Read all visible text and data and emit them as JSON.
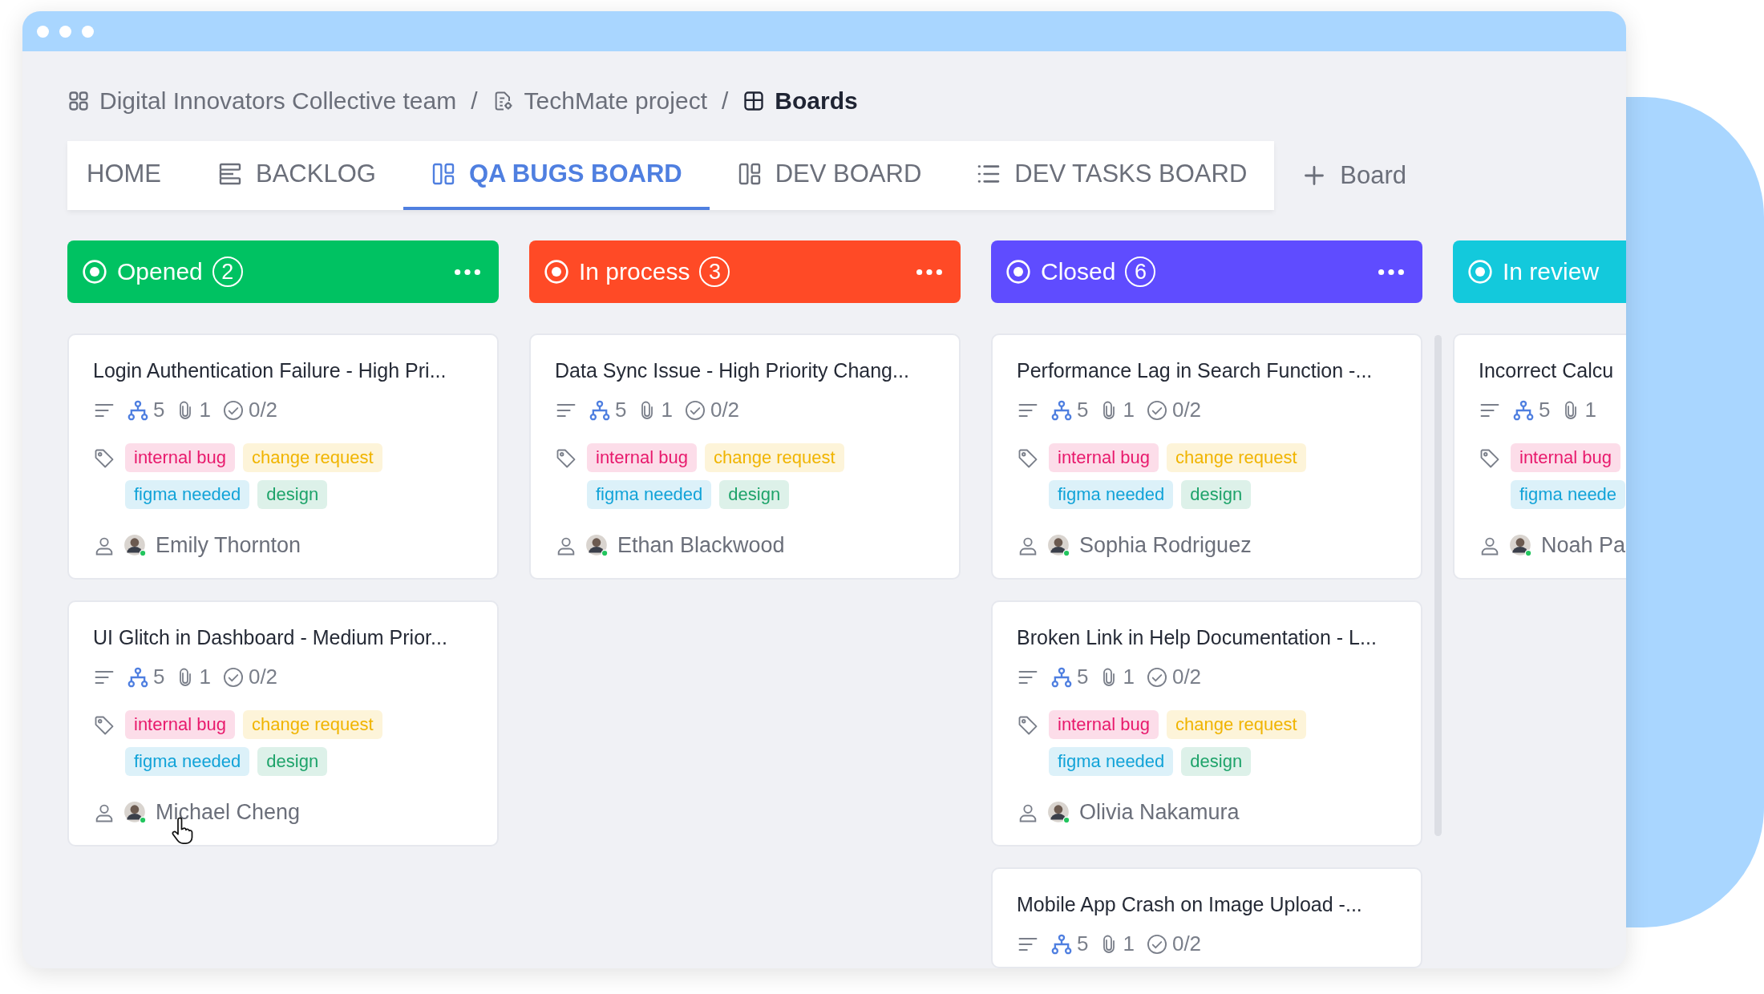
{
  "breadcrumb": [
    {
      "label": "Digital Innovators Collective team",
      "kind": "team",
      "current": false
    },
    {
      "label": "TechMate project",
      "kind": "project",
      "current": false
    },
    {
      "label": "Boards",
      "kind": "boards",
      "current": true
    }
  ],
  "separator": "/",
  "tabs": [
    {
      "label": "HOME",
      "kind": "plain",
      "selected": false
    },
    {
      "label": "BACKLOG",
      "kind": "backlog",
      "selected": false
    },
    {
      "label": "QA BUGS BOARD",
      "kind": "board",
      "selected": true
    },
    {
      "label": "DEV BOARD",
      "kind": "board",
      "selected": false
    },
    {
      "label": "DEV TASKS BOARD",
      "kind": "list",
      "selected": false
    }
  ],
  "add_board": {
    "label": "Board"
  },
  "columns": [
    {
      "name": "Opened",
      "count": "2",
      "color": "#00c262",
      "cards": [
        {
          "title": "Login Authentication Failure - High Pri...",
          "subtasks": "5",
          "attachments": "1",
          "checklist": "0/2",
          "tags": [
            {
              "label": "internal bug",
              "color": "#e8196c"
            },
            {
              "label": "change request",
              "color": "#f0b400"
            },
            {
              "label": "figma needed",
              "color": "#12a3d8"
            },
            {
              "label": "design",
              "color": "#1ea36a"
            }
          ],
          "assignee": "Emily Thornton"
        },
        {
          "title": "UI Glitch in Dashboard - Medium Prior...",
          "subtasks": "5",
          "attachments": "1",
          "checklist": "0/2",
          "tags": [
            {
              "label": "internal bug",
              "color": "#e8196c"
            },
            {
              "label": "change request",
              "color": "#f0b400"
            },
            {
              "label": "figma needed",
              "color": "#12a3d8"
            },
            {
              "label": "design",
              "color": "#1ea36a"
            }
          ],
          "assignee": "Michael Cheng"
        }
      ]
    },
    {
      "name": "In process",
      "count": "3",
      "color": "#ff4a26",
      "cards": [
        {
          "title": "Data Sync Issue - High Priority Chang...",
          "subtasks": "5",
          "attachments": "1",
          "checklist": "0/2",
          "tags": [
            {
              "label": "internal bug",
              "color": "#e8196c"
            },
            {
              "label": "change request",
              "color": "#f0b400"
            },
            {
              "label": "figma needed",
              "color": "#12a3d8"
            },
            {
              "label": "design",
              "color": "#1ea36a"
            }
          ],
          "assignee": "Ethan Blackwood"
        }
      ]
    },
    {
      "name": "Closed",
      "count": "6",
      "color": "#5f4cff",
      "cards": [
        {
          "title": "Performance Lag in Search Function -...",
          "subtasks": "5",
          "attachments": "1",
          "checklist": "0/2",
          "tags": [
            {
              "label": "internal bug",
              "color": "#e8196c"
            },
            {
              "label": "change request",
              "color": "#f0b400"
            },
            {
              "label": "figma needed",
              "color": "#12a3d8"
            },
            {
              "label": "design",
              "color": "#1ea36a"
            }
          ],
          "assignee": "Sophia Rodriguez"
        },
        {
          "title": "Broken Link in Help Documentation - L...",
          "subtasks": "5",
          "attachments": "1",
          "checklist": "0/2",
          "tags": [
            {
              "label": "internal bug",
              "color": "#e8196c"
            },
            {
              "label": "change request",
              "color": "#f0b400"
            },
            {
              "label": "figma needed",
              "color": "#12a3d8"
            },
            {
              "label": "design",
              "color": "#1ea36a"
            }
          ],
          "assignee": "Olivia Nakamura"
        },
        {
          "title": "Mobile App Crash on Image Upload -...",
          "subtasks": "5",
          "attachments": "1",
          "checklist": "0/2"
        }
      ]
    },
    {
      "name": "In review",
      "color": "#13c9dc",
      "cards": [
        {
          "title": "Incorrect Calcu",
          "subtasks": "5",
          "attachments": "1",
          "tags": [
            {
              "label": "internal bug",
              "color": "#e8196c"
            },
            {
              "label": "figma neede",
              "color": "#12a3d8"
            }
          ],
          "assignee": "Noah Pa"
        }
      ]
    }
  ]
}
